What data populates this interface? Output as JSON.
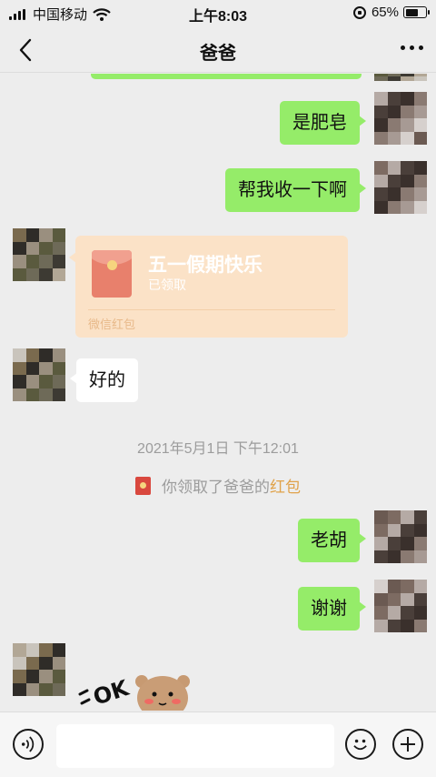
{
  "status_bar": {
    "carrier": "中国移动",
    "time": "上午8:03",
    "battery": "65%",
    "battery_level": 0.65,
    "icons": [
      "signal-icon",
      "wifi-icon",
      "orientation-lock-icon",
      "battery-icon"
    ]
  },
  "nav": {
    "title": "爸爸",
    "icons": [
      "back-chevron-icon",
      "more-icon"
    ]
  },
  "messages": [
    {
      "side": "out",
      "text": "是肥皂"
    },
    {
      "side": "out",
      "text": "帮我收一下啊"
    },
    {
      "side": "in",
      "type": "red_packet",
      "title": "五一假期快乐",
      "status": "已领取",
      "footer": "微信红包"
    },
    {
      "side": "in",
      "text": "好的"
    },
    {
      "type": "timestamp",
      "text": "2021年5月1日 下午12:01"
    },
    {
      "type": "system",
      "prefix": "你领取了爸爸的",
      "link": "红包"
    },
    {
      "side": "out",
      "text": "老胡"
    },
    {
      "side": "out",
      "text": "谢谢"
    },
    {
      "side": "in",
      "type": "sticker",
      "text": "OK"
    }
  ],
  "input_bar": {
    "placeholder": "",
    "icons": [
      "voice-icon",
      "emoji-icon",
      "plus-icon"
    ]
  },
  "colors": {
    "outgoing_bubble": "#95ec69",
    "incoming_bubble": "#ffffff",
    "background": "#ededed",
    "red_packet": "#fbe2c7",
    "link": "#e0a24a"
  }
}
